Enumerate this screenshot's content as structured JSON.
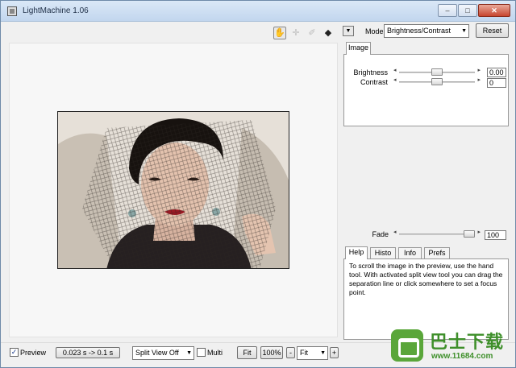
{
  "window": {
    "title": "LightMachine 1.06"
  },
  "tools": {
    "hand": "hand-tool-icon",
    "crosshair": "crosshair-tool-icon",
    "eyedropper": "eyedropper-tool-icon",
    "split": "split-view-tool-icon"
  },
  "mode": {
    "label": "Mode",
    "selected": "Brightness/Contrast",
    "reset_label": "Reset"
  },
  "image_panel": {
    "tab_label": "Image",
    "brightness": {
      "label": "Brightness",
      "value": "0.00",
      "level": 0.5
    },
    "contrast": {
      "label": "Contrast",
      "value": "0",
      "level": 0.5
    }
  },
  "fade": {
    "label": "Fade",
    "value": "100",
    "level": 1.0
  },
  "info_tabs": [
    {
      "label": "Help"
    },
    {
      "label": "Histo"
    },
    {
      "label": "Info"
    },
    {
      "label": "Prefs"
    }
  ],
  "help_text": "To scroll the image in the preview, use the hand tool. With activated split view tool you can drag the separation line or click somewhere to set a focus point.",
  "statusbar": {
    "preview_label": "Preview",
    "preview_checked": true,
    "speed_label": "0.023 s -> 0.1 s",
    "split_view": "Split View Off",
    "multi_label": "Multi",
    "multi_checked": false,
    "fit_label": "Fit",
    "zoom_label": "100%",
    "minus_label": "-",
    "zoom_select": "Fit",
    "plus_label": "+"
  },
  "watermark": {
    "text": "巴士下载",
    "url": "www.11684.com"
  },
  "colors": {
    "titlebar": "#c2d6ee",
    "watermark_green": "#3e8f2a"
  }
}
